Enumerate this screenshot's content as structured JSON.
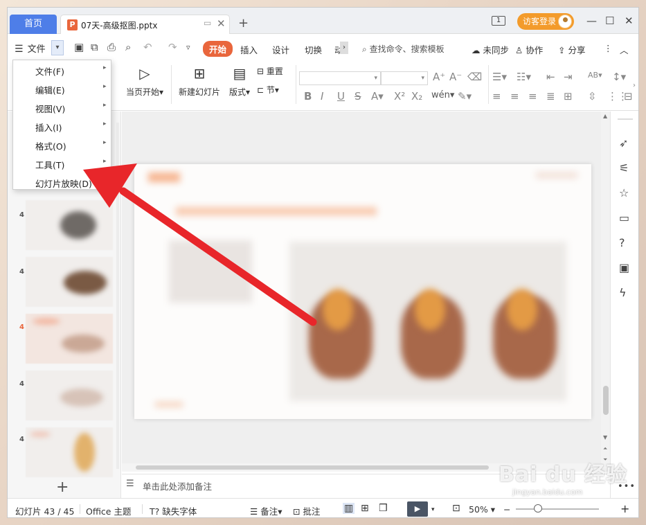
{
  "titlebar": {
    "home_tab": "首页",
    "doc_tab_icon": "P",
    "doc_title": "07天-高级抠图.pptx",
    "page_indicator": "1",
    "guest_login": "访客登录"
  },
  "menubar": {
    "file_menu": "文件",
    "tabs": [
      "开始",
      "插入",
      "设计",
      "切换",
      "动"
    ],
    "active_tab": "开始",
    "search_placeholder": "查找命令、搜索模板",
    "unsynced": "未同步",
    "collaborate": "协作",
    "share": "分享"
  },
  "ribbon": {
    "play_current": "当页开始",
    "new_slide": "新建幻灯片",
    "layout": "版式",
    "reset": "重置",
    "section": "节"
  },
  "file_dropdown": {
    "items": [
      {
        "label": "文件(F)",
        "has_submenu": true
      },
      {
        "label": "编辑(E)",
        "has_submenu": true
      },
      {
        "label": "视图(V)",
        "has_submenu": true
      },
      {
        "label": "插入(I)",
        "has_submenu": true
      },
      {
        "label": "格式(O)",
        "has_submenu": true
      },
      {
        "label": "工具(T)",
        "has_submenu": true
      },
      {
        "label": "幻灯片放映(D)",
        "has_submenu": false
      }
    ]
  },
  "slides_pane": {
    "numbers": [
      "4",
      "4",
      "4",
      "4",
      "4"
    ],
    "active_index": 2
  },
  "notes": {
    "placeholder": "单击此处添加备注"
  },
  "statusbar": {
    "slide_counter": "幻灯片 43 / 45",
    "theme": "Office 主题",
    "missing_font": "缺失字体",
    "notes": "备注",
    "comments": "批注",
    "zoom": "50%"
  },
  "watermark": {
    "main": "Bai du 经验",
    "sub": "jingyan.baidu.com"
  },
  "colors": {
    "accent": "#e9663c",
    "home_tab": "#4e7ee8",
    "guest_login": "#f39b2b",
    "annotation_arrow": "#e8262a"
  }
}
